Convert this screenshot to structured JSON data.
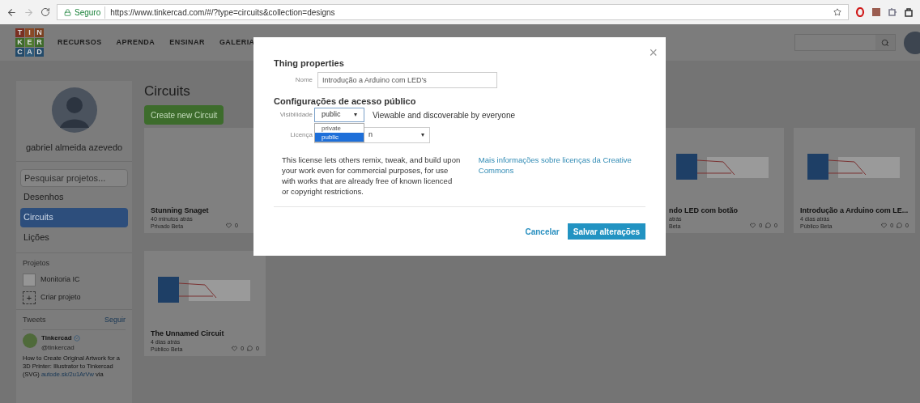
{
  "browser": {
    "secure_label": "Seguro",
    "url": "https://www.tinkercad.com/#/?type=circuits&collection=designs"
  },
  "nav": {
    "logo": [
      [
        "T",
        "I",
        "N"
      ],
      [
        "K",
        "E",
        "R"
      ],
      [
        "C",
        "A",
        "D"
      ]
    ],
    "links": [
      "RECURSOS",
      "APRENDA",
      "ENSINAR",
      "GALERIA"
    ]
  },
  "sidebar": {
    "user_name": "gabriel almeida azevedo",
    "search": {
      "placeholder": "Pesquisar projetos..."
    },
    "items": [
      {
        "label": "Desenhos",
        "selected": false
      },
      {
        "label": "Circuits",
        "selected": true
      },
      {
        "label": "Lições",
        "selected": false
      }
    ],
    "projects_heading": "Projetos",
    "projects": [
      "Monitoria IC"
    ],
    "create_project": {
      "icon": "+",
      "label": "Criar projeto"
    },
    "tweets": {
      "heading": "Tweets",
      "follow": "Seguir",
      "tweet": {
        "author": "Tinkercad",
        "handle": "@tinkercad",
        "text": "How to Create Original Artwork for a 3D Printer: Illustrator to Tinkercad (SVG)",
        "link": "autode.sk/2u1ArVw",
        "after": "via"
      }
    }
  },
  "main": {
    "title": "Circuits",
    "create_button": "Create new Circuit",
    "card_rows": [
      [
        {
          "kind": "empty",
          "title": "Stunning Snaget",
          "time": "40 minutos atrás",
          "privacy": "Privado Beta",
          "likes": "0"
        },
        {
          "kind": "circuit",
          "title": "ndo LED com botão",
          "time": "atrás",
          "privacy": "Beta",
          "likes": "0",
          "comments": "0"
        },
        {
          "kind": "circuit",
          "title": "Introdução a Arduino com LE...",
          "time": "4 dias atrás",
          "privacy": "Público Beta",
          "likes": "0",
          "comments": "0"
        }
      ],
      [
        {
          "kind": "circuit",
          "title": "The Unnamed Circuit",
          "time": "4 dias atrás",
          "privacy": "Público Beta",
          "likes": "0",
          "comments": "0"
        }
      ]
    ]
  },
  "dialog": {
    "close": "×",
    "title": "Thing properties",
    "name_label": "Nome",
    "name_value": "Introdução a Arduino com LED's",
    "access_heading": "Configurações de acesso público",
    "visibility_label": "Visibilidade",
    "visibility_value": "public",
    "visibility_caret": "▾",
    "visibility_note": "Viewable and discoverable by everyone",
    "visibility_options": [
      {
        "label": "private",
        "selected": false
      },
      {
        "label": "public",
        "selected": true
      }
    ],
    "license_label": "Licença",
    "license_value": "n",
    "license_caret": "▾",
    "license_text": "This license lets others remix, tweak, and build upon your work even for commercial purposes, for use with works that are already free of known licenced or copyright restrictions.",
    "license_link": "Mais informações sobre licenças da Creative Commons",
    "cancel": "Cancelar",
    "save": "Salvar alterações"
  }
}
